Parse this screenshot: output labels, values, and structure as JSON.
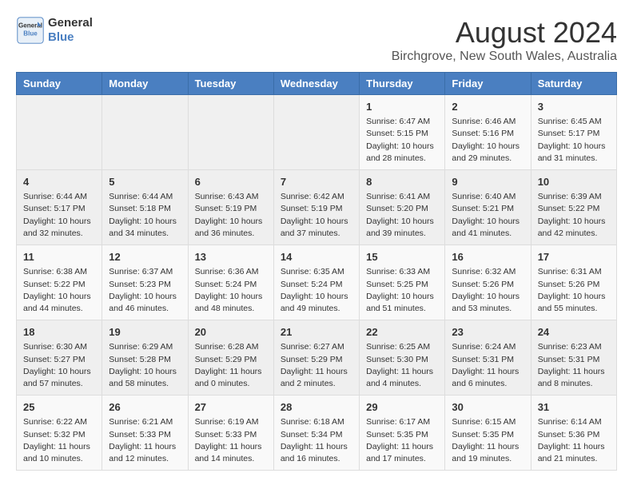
{
  "header": {
    "logo_line1": "General",
    "logo_line2": "Blue",
    "month_year": "August 2024",
    "location": "Birchgrove, New South Wales, Australia"
  },
  "days_of_week": [
    "Sunday",
    "Monday",
    "Tuesday",
    "Wednesday",
    "Thursday",
    "Friday",
    "Saturday"
  ],
  "weeks": [
    [
      {
        "day": "",
        "info": ""
      },
      {
        "day": "",
        "info": ""
      },
      {
        "day": "",
        "info": ""
      },
      {
        "day": "",
        "info": ""
      },
      {
        "day": "1",
        "info": "Sunrise: 6:47 AM\nSunset: 5:15 PM\nDaylight: 10 hours\nand 28 minutes."
      },
      {
        "day": "2",
        "info": "Sunrise: 6:46 AM\nSunset: 5:16 PM\nDaylight: 10 hours\nand 29 minutes."
      },
      {
        "day": "3",
        "info": "Sunrise: 6:45 AM\nSunset: 5:17 PM\nDaylight: 10 hours\nand 31 minutes."
      }
    ],
    [
      {
        "day": "4",
        "info": "Sunrise: 6:44 AM\nSunset: 5:17 PM\nDaylight: 10 hours\nand 32 minutes."
      },
      {
        "day": "5",
        "info": "Sunrise: 6:44 AM\nSunset: 5:18 PM\nDaylight: 10 hours\nand 34 minutes."
      },
      {
        "day": "6",
        "info": "Sunrise: 6:43 AM\nSunset: 5:19 PM\nDaylight: 10 hours\nand 36 minutes."
      },
      {
        "day": "7",
        "info": "Sunrise: 6:42 AM\nSunset: 5:19 PM\nDaylight: 10 hours\nand 37 minutes."
      },
      {
        "day": "8",
        "info": "Sunrise: 6:41 AM\nSunset: 5:20 PM\nDaylight: 10 hours\nand 39 minutes."
      },
      {
        "day": "9",
        "info": "Sunrise: 6:40 AM\nSunset: 5:21 PM\nDaylight: 10 hours\nand 41 minutes."
      },
      {
        "day": "10",
        "info": "Sunrise: 6:39 AM\nSunset: 5:22 PM\nDaylight: 10 hours\nand 42 minutes."
      }
    ],
    [
      {
        "day": "11",
        "info": "Sunrise: 6:38 AM\nSunset: 5:22 PM\nDaylight: 10 hours\nand 44 minutes."
      },
      {
        "day": "12",
        "info": "Sunrise: 6:37 AM\nSunset: 5:23 PM\nDaylight: 10 hours\nand 46 minutes."
      },
      {
        "day": "13",
        "info": "Sunrise: 6:36 AM\nSunset: 5:24 PM\nDaylight: 10 hours\nand 48 minutes."
      },
      {
        "day": "14",
        "info": "Sunrise: 6:35 AM\nSunset: 5:24 PM\nDaylight: 10 hours\nand 49 minutes."
      },
      {
        "day": "15",
        "info": "Sunrise: 6:33 AM\nSunset: 5:25 PM\nDaylight: 10 hours\nand 51 minutes."
      },
      {
        "day": "16",
        "info": "Sunrise: 6:32 AM\nSunset: 5:26 PM\nDaylight: 10 hours\nand 53 minutes."
      },
      {
        "day": "17",
        "info": "Sunrise: 6:31 AM\nSunset: 5:26 PM\nDaylight: 10 hours\nand 55 minutes."
      }
    ],
    [
      {
        "day": "18",
        "info": "Sunrise: 6:30 AM\nSunset: 5:27 PM\nDaylight: 10 hours\nand 57 minutes."
      },
      {
        "day": "19",
        "info": "Sunrise: 6:29 AM\nSunset: 5:28 PM\nDaylight: 10 hours\nand 58 minutes."
      },
      {
        "day": "20",
        "info": "Sunrise: 6:28 AM\nSunset: 5:29 PM\nDaylight: 11 hours\nand 0 minutes."
      },
      {
        "day": "21",
        "info": "Sunrise: 6:27 AM\nSunset: 5:29 PM\nDaylight: 11 hours\nand 2 minutes."
      },
      {
        "day": "22",
        "info": "Sunrise: 6:25 AM\nSunset: 5:30 PM\nDaylight: 11 hours\nand 4 minutes."
      },
      {
        "day": "23",
        "info": "Sunrise: 6:24 AM\nSunset: 5:31 PM\nDaylight: 11 hours\nand 6 minutes."
      },
      {
        "day": "24",
        "info": "Sunrise: 6:23 AM\nSunset: 5:31 PM\nDaylight: 11 hours\nand 8 minutes."
      }
    ],
    [
      {
        "day": "25",
        "info": "Sunrise: 6:22 AM\nSunset: 5:32 PM\nDaylight: 11 hours\nand 10 minutes."
      },
      {
        "day": "26",
        "info": "Sunrise: 6:21 AM\nSunset: 5:33 PM\nDaylight: 11 hours\nand 12 minutes."
      },
      {
        "day": "27",
        "info": "Sunrise: 6:19 AM\nSunset: 5:33 PM\nDaylight: 11 hours\nand 14 minutes."
      },
      {
        "day": "28",
        "info": "Sunrise: 6:18 AM\nSunset: 5:34 PM\nDaylight: 11 hours\nand 16 minutes."
      },
      {
        "day": "29",
        "info": "Sunrise: 6:17 AM\nSunset: 5:35 PM\nDaylight: 11 hours\nand 17 minutes."
      },
      {
        "day": "30",
        "info": "Sunrise: 6:15 AM\nSunset: 5:35 PM\nDaylight: 11 hours\nand 19 minutes."
      },
      {
        "day": "31",
        "info": "Sunrise: 6:14 AM\nSunset: 5:36 PM\nDaylight: 11 hours\nand 21 minutes."
      }
    ]
  ]
}
